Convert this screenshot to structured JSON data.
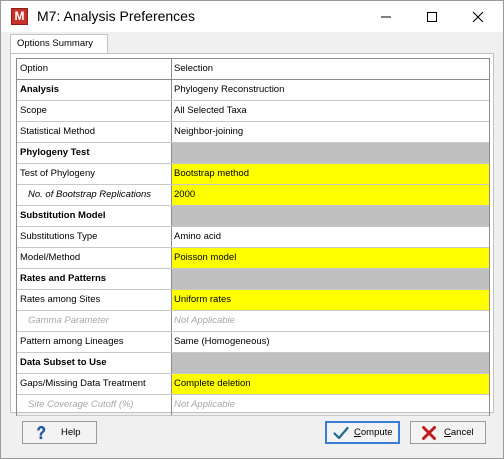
{
  "window": {
    "title": "M7: Analysis Preferences",
    "app_icon_letter": "M"
  },
  "tabs": [
    {
      "label": "Options Summary",
      "active": true
    }
  ],
  "table": {
    "headers": {
      "option": "Option",
      "selection": "Selection"
    },
    "rows": [
      {
        "option": "Analysis",
        "selection": "Phylogeny Reconstruction",
        "option_style": "section-bold",
        "selection_style": "plain"
      },
      {
        "option": "Scope",
        "selection": "All Selected Taxa",
        "option_style": "normal",
        "selection_style": "plain"
      },
      {
        "option": "Statistical Method",
        "selection": "Neighbor-joining",
        "option_style": "normal",
        "selection_style": "plain"
      },
      {
        "option": "Phylogeny Test",
        "selection": "",
        "option_style": "section-bold",
        "selection_style": "gray"
      },
      {
        "option": "Test of Phylogeny",
        "selection": "Bootstrap method",
        "option_style": "normal",
        "selection_style": "yellow"
      },
      {
        "option": "No. of Bootstrap Replications",
        "selection": "2000",
        "option_style": "italic-indent",
        "selection_style": "yellow"
      },
      {
        "option": "Substitution Model",
        "selection": "",
        "option_style": "section-bold",
        "selection_style": "gray"
      },
      {
        "option": "Substitutions Type",
        "selection": "Amino acid",
        "option_style": "normal",
        "selection_style": "plain"
      },
      {
        "option": "Model/Method",
        "selection": "Poisson model",
        "option_style": "normal",
        "selection_style": "yellow"
      },
      {
        "option": "Rates and Patterns",
        "selection": "",
        "option_style": "section-bold",
        "selection_style": "gray"
      },
      {
        "option": "Rates among Sites",
        "selection": "Uniform rates",
        "option_style": "normal",
        "selection_style": "yellow"
      },
      {
        "option": "Gamma Parameter",
        "selection": "Not Applicable",
        "option_style": "disabled-indent",
        "selection_style": "disabled"
      },
      {
        "option": "Pattern among Lineages",
        "selection": "Same (Homogeneous)",
        "option_style": "normal",
        "selection_style": "plain"
      },
      {
        "option": "Data Subset to Use",
        "selection": "",
        "option_style": "section-bold",
        "selection_style": "gray"
      },
      {
        "option": "Gaps/Missing Data Treatment",
        "selection": "Complete deletion",
        "option_style": "normal",
        "selection_style": "yellow"
      },
      {
        "option": "Site Coverage Cutoff (%)",
        "selection": "Not Applicable",
        "option_style": "disabled-indent",
        "selection_style": "disabled"
      }
    ]
  },
  "buttons": {
    "help": {
      "label": "Help",
      "icon": "question-icon"
    },
    "compute": {
      "label_underlined": "C",
      "label_rest": "ompute",
      "icon": "checkmark-icon"
    },
    "cancel": {
      "label_underlined": "C",
      "label_rest": "ancel",
      "icon": "x-icon"
    }
  },
  "colors": {
    "selection_highlight": "#ffff00",
    "section_fill": "#c0c0c0",
    "disabled_text": "#a8a8a8",
    "app_icon": "#c8302a",
    "default_button_border": "#3b7dd0"
  }
}
